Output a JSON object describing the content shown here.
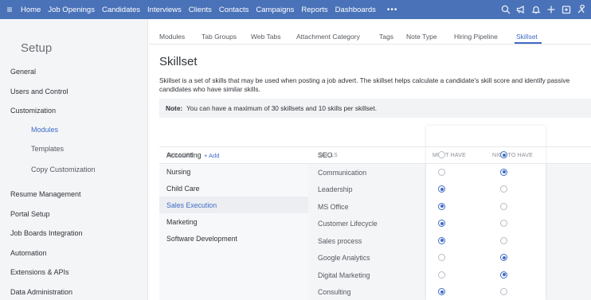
{
  "topnav": {
    "menu_icon": "≡",
    "items": [
      "Home",
      "Job Openings",
      "Candidates",
      "Interviews",
      "Clients",
      "Contacts",
      "Campaigns",
      "Reports",
      "Dashboards"
    ],
    "more": "•••",
    "icons": [
      "search-icon",
      "megaphone-icon",
      "bell-icon",
      "plus-icon",
      "calendar-icon",
      "settings-icon"
    ],
    "bg_color": "#4a72b8"
  },
  "sidebar": {
    "title": "Setup",
    "items": [
      {
        "label": "General"
      },
      {
        "label": "Users and Control"
      },
      {
        "label": "Customization"
      },
      {
        "label": "Modules"
      },
      {
        "label": "Templates"
      },
      {
        "label": "Copy Customization"
      },
      {
        "label": "Resume Management"
      },
      {
        "label": "Portal Setup"
      },
      {
        "label": "Job Boards Integration"
      },
      {
        "label": "Automation"
      },
      {
        "label": "Extensions & APIs"
      },
      {
        "label": "Data Administration"
      }
    ]
  },
  "tabs": [
    "Modules",
    "Tab Groups",
    "Web Tabs",
    "Attachment Category",
    "Tags",
    "Note Type",
    "Hiring Pipeline",
    "Skillset"
  ],
  "page": {
    "title": "Skillset",
    "description": "Skillset is a set of skills that may be used when posting a job advert. The skillset helps calculate a candidate's skill score and identify passive candidates who have similar skills.",
    "note_label": "Note:",
    "note_text": "You can have a maximum of 30 skillsets and 10 skills per skillset."
  },
  "table": {
    "headers": {
      "skillset": "SKILLSET",
      "add": "+ Add",
      "skills": "SKILLS",
      "must_have": "MUST HAVE",
      "nice_to_have": "NICE TO HAVE"
    },
    "skillsets": [
      "Accounting",
      "Nursing",
      "Child Care",
      "Sales Execution",
      "Marketing",
      "Software Development"
    ],
    "selected_skillset": "Sales Execution",
    "skills": [
      {
        "name": "SEO",
        "priority": "nice_to_have"
      },
      {
        "name": "Communication",
        "priority": "nice_to_have"
      },
      {
        "name": "Leadership",
        "priority": "must_have"
      },
      {
        "name": "MS Office",
        "priority": "must_have"
      },
      {
        "name": "Customer Lifecycle",
        "priority": "must_have"
      },
      {
        "name": "Sales process",
        "priority": "must_have"
      },
      {
        "name": "Google Analytics",
        "priority": "nice_to_have"
      },
      {
        "name": "Digital Marketing",
        "priority": "nice_to_have"
      },
      {
        "name": "Consulting",
        "priority": "must_have"
      }
    ]
  },
  "accent_color": "#3f6cc4"
}
